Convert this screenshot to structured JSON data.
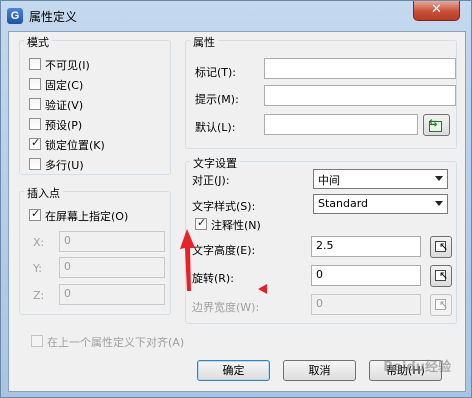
{
  "window": {
    "title": "属性定义",
    "app_icon_letter": "G",
    "close_symbol": "✕"
  },
  "mode": {
    "title": "模式",
    "options": [
      {
        "label": "不可见(I)",
        "checked": false
      },
      {
        "label": "固定(C)",
        "checked": false
      },
      {
        "label": "验证(V)",
        "checked": false
      },
      {
        "label": "预设(P)",
        "checked": false
      },
      {
        "label": "锁定位置(K)",
        "checked": true
      },
      {
        "label": "多行(U)",
        "checked": false
      }
    ]
  },
  "insert_point": {
    "title": "插入点",
    "specify_on_screen": {
      "label": "在屏幕上指定(O)",
      "checked": true
    },
    "x": {
      "label": "X:",
      "value": "0"
    },
    "y": {
      "label": "Y:",
      "value": "0"
    },
    "z": {
      "label": "Z:",
      "value": "0"
    }
  },
  "attribute": {
    "title": "属性",
    "tag": {
      "label": "标记(T):",
      "value": ""
    },
    "prompt": {
      "label": "提示(M):",
      "value": ""
    },
    "default": {
      "label": "默认(L):",
      "value": ""
    }
  },
  "text_settings": {
    "title": "文字设置",
    "justification": {
      "label": "对正(J):",
      "value": "中间"
    },
    "text_style": {
      "label": "文字样式(S):",
      "value": "Standard"
    },
    "annotative": {
      "label": "注释性(N)",
      "checked": true
    },
    "text_height": {
      "label": "文字高度(E):",
      "value": "2.5"
    },
    "rotation": {
      "label": "旋转(R):",
      "value": "0"
    },
    "boundary_width": {
      "label": "边界宽度(W):",
      "value": "0"
    }
  },
  "align_below": {
    "label": "在上一个属性定义下对齐(A)",
    "checked": false
  },
  "buttons": {
    "ok": "确定",
    "cancel": "取消",
    "help": "帮助(H)"
  },
  "watermark": "Baidu经验",
  "colors": {
    "annotation_arrow": "#e8202a",
    "titlebar_top": "#c4d8ee",
    "close_button": "#c7503a"
  }
}
